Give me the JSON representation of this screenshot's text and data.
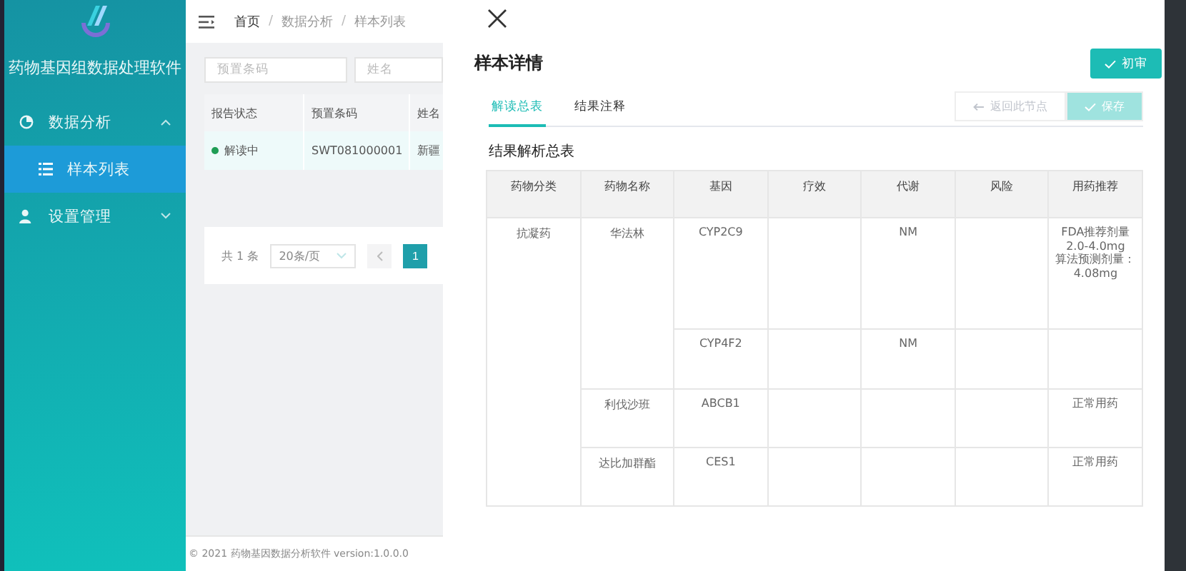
{
  "sidebar": {
    "app_title": "药物基因组数据处理软件",
    "menu": [
      {
        "label": "数据分析",
        "expanded": true,
        "children": [
          {
            "label": "样本列表",
            "selected": true
          }
        ]
      },
      {
        "label": "设置管理",
        "expanded": false
      }
    ]
  },
  "header": {
    "breadcrumb": [
      "首页",
      "数据分析",
      "样本列表"
    ],
    "separator": "/"
  },
  "list": {
    "filters": [
      {
        "placeholder": "预置条码"
      },
      {
        "placeholder": "姓名"
      }
    ],
    "columns": [
      "报告状态",
      "预置条码",
      "姓名"
    ],
    "rows": [
      {
        "status": "解读中",
        "color": "#1f9d55",
        "barcode": "SWT081000001",
        "name": "新疆"
      }
    ],
    "pagination": {
      "total": "共 1 条",
      "page_size": "20条/页",
      "pages": [
        {
          "label": "1",
          "selected": true
        }
      ]
    },
    "footer": "© 2021 药物基因数据分析软件 version:1.0.0.0"
  },
  "drawer": {
    "title": "样本详情",
    "approve_button": "初审",
    "tabs": [
      {
        "label": "解读总表",
        "selected": true
      },
      {
        "label": "结果注释",
        "selected": false
      }
    ],
    "actions": [
      {
        "label": "返回此节点",
        "kind": "back",
        "disabled": true
      },
      {
        "label": "保存",
        "kind": "save",
        "disabled": true
      }
    ],
    "section_title": "结果解析总表",
    "columns": [
      "药物分类",
      "药物名称",
      "基因",
      "疗效",
      "代谢",
      "风险",
      "用药推荐"
    ],
    "groups": [
      {
        "class": "抗凝药",
        "drugs": [
          {
            "name": "华法林",
            "genes": [
              {
                "gene": "CYP2C9",
                "metabolism": "NM",
                "recommendation": [
                  "FDA推荐剂量",
                  "2.0-4.0mg",
                  "算法预测剂量：",
                  "4.08mg"
                ]
              },
              {
                "gene": "CYP4F2",
                "metabolism": "NM"
              }
            ]
          },
          {
            "name": "利伐沙班",
            "genes": [
              {
                "gene": "ABCB1",
                "recommendation": [
                  "正常用药"
                ]
              }
            ]
          },
          {
            "name": "达比加群酯",
            "genes": [
              {
                "gene": "CES1",
                "recommendation": [
                  "正常用药"
                ]
              }
            ]
          }
        ]
      }
    ]
  }
}
